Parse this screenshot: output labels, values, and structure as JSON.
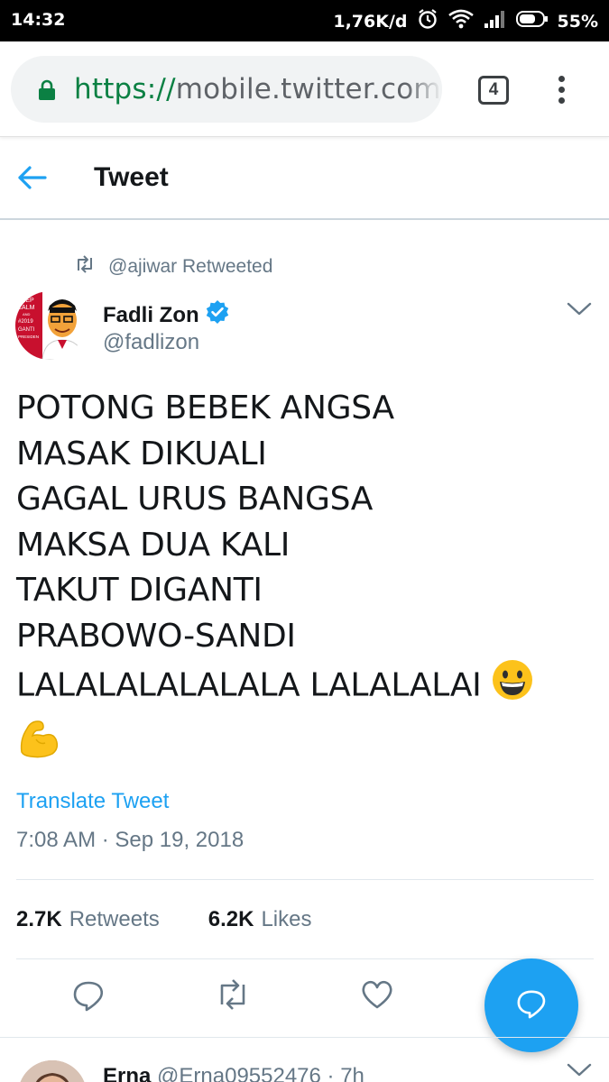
{
  "status_bar": {
    "time": "14:32",
    "net_speed": "1,76K/d",
    "battery": "55%"
  },
  "browser": {
    "url_scheme": "https://",
    "url_rest": "mobile.twitter.com/fadlizon",
    "tab_count": "4"
  },
  "header": {
    "title": "Tweet"
  },
  "tweet": {
    "retweeted_by": "@ajiwar Retweeted",
    "author_name": "Fadli Zon",
    "author_handle": "@fadlizon",
    "avatar_text": {
      "l1": "KEEP",
      "l2": "CALM",
      "l3": "AND",
      "l4": "#2019",
      "l5": "GANTI",
      "l6": "PRESIDEN"
    },
    "lines": [
      "POTONG BEBEK ANGSA",
      "MASAK DIKUALI",
      "GAGAL URUS BANGSA",
      "MAKSA DUA KALI",
      "TAKUT DIGANTI",
      "PRABOWO-SANDI",
      "LALALALALALALA LALALALAI"
    ],
    "translate_label": "Translate Tweet",
    "timestamp": "7:08 AM · Sep 19, 2018",
    "retweets_count": "2.7K",
    "retweets_label": "Retweets",
    "likes_count": "6.2K",
    "likes_label": "Likes"
  },
  "next_reply": {
    "name": "Erna",
    "handle_time": "@Erna09552476 · 7h"
  },
  "colors": {
    "twitter_blue": "#1da1f2",
    "secondary_text": "#657786",
    "lock_green": "#0b8043"
  }
}
